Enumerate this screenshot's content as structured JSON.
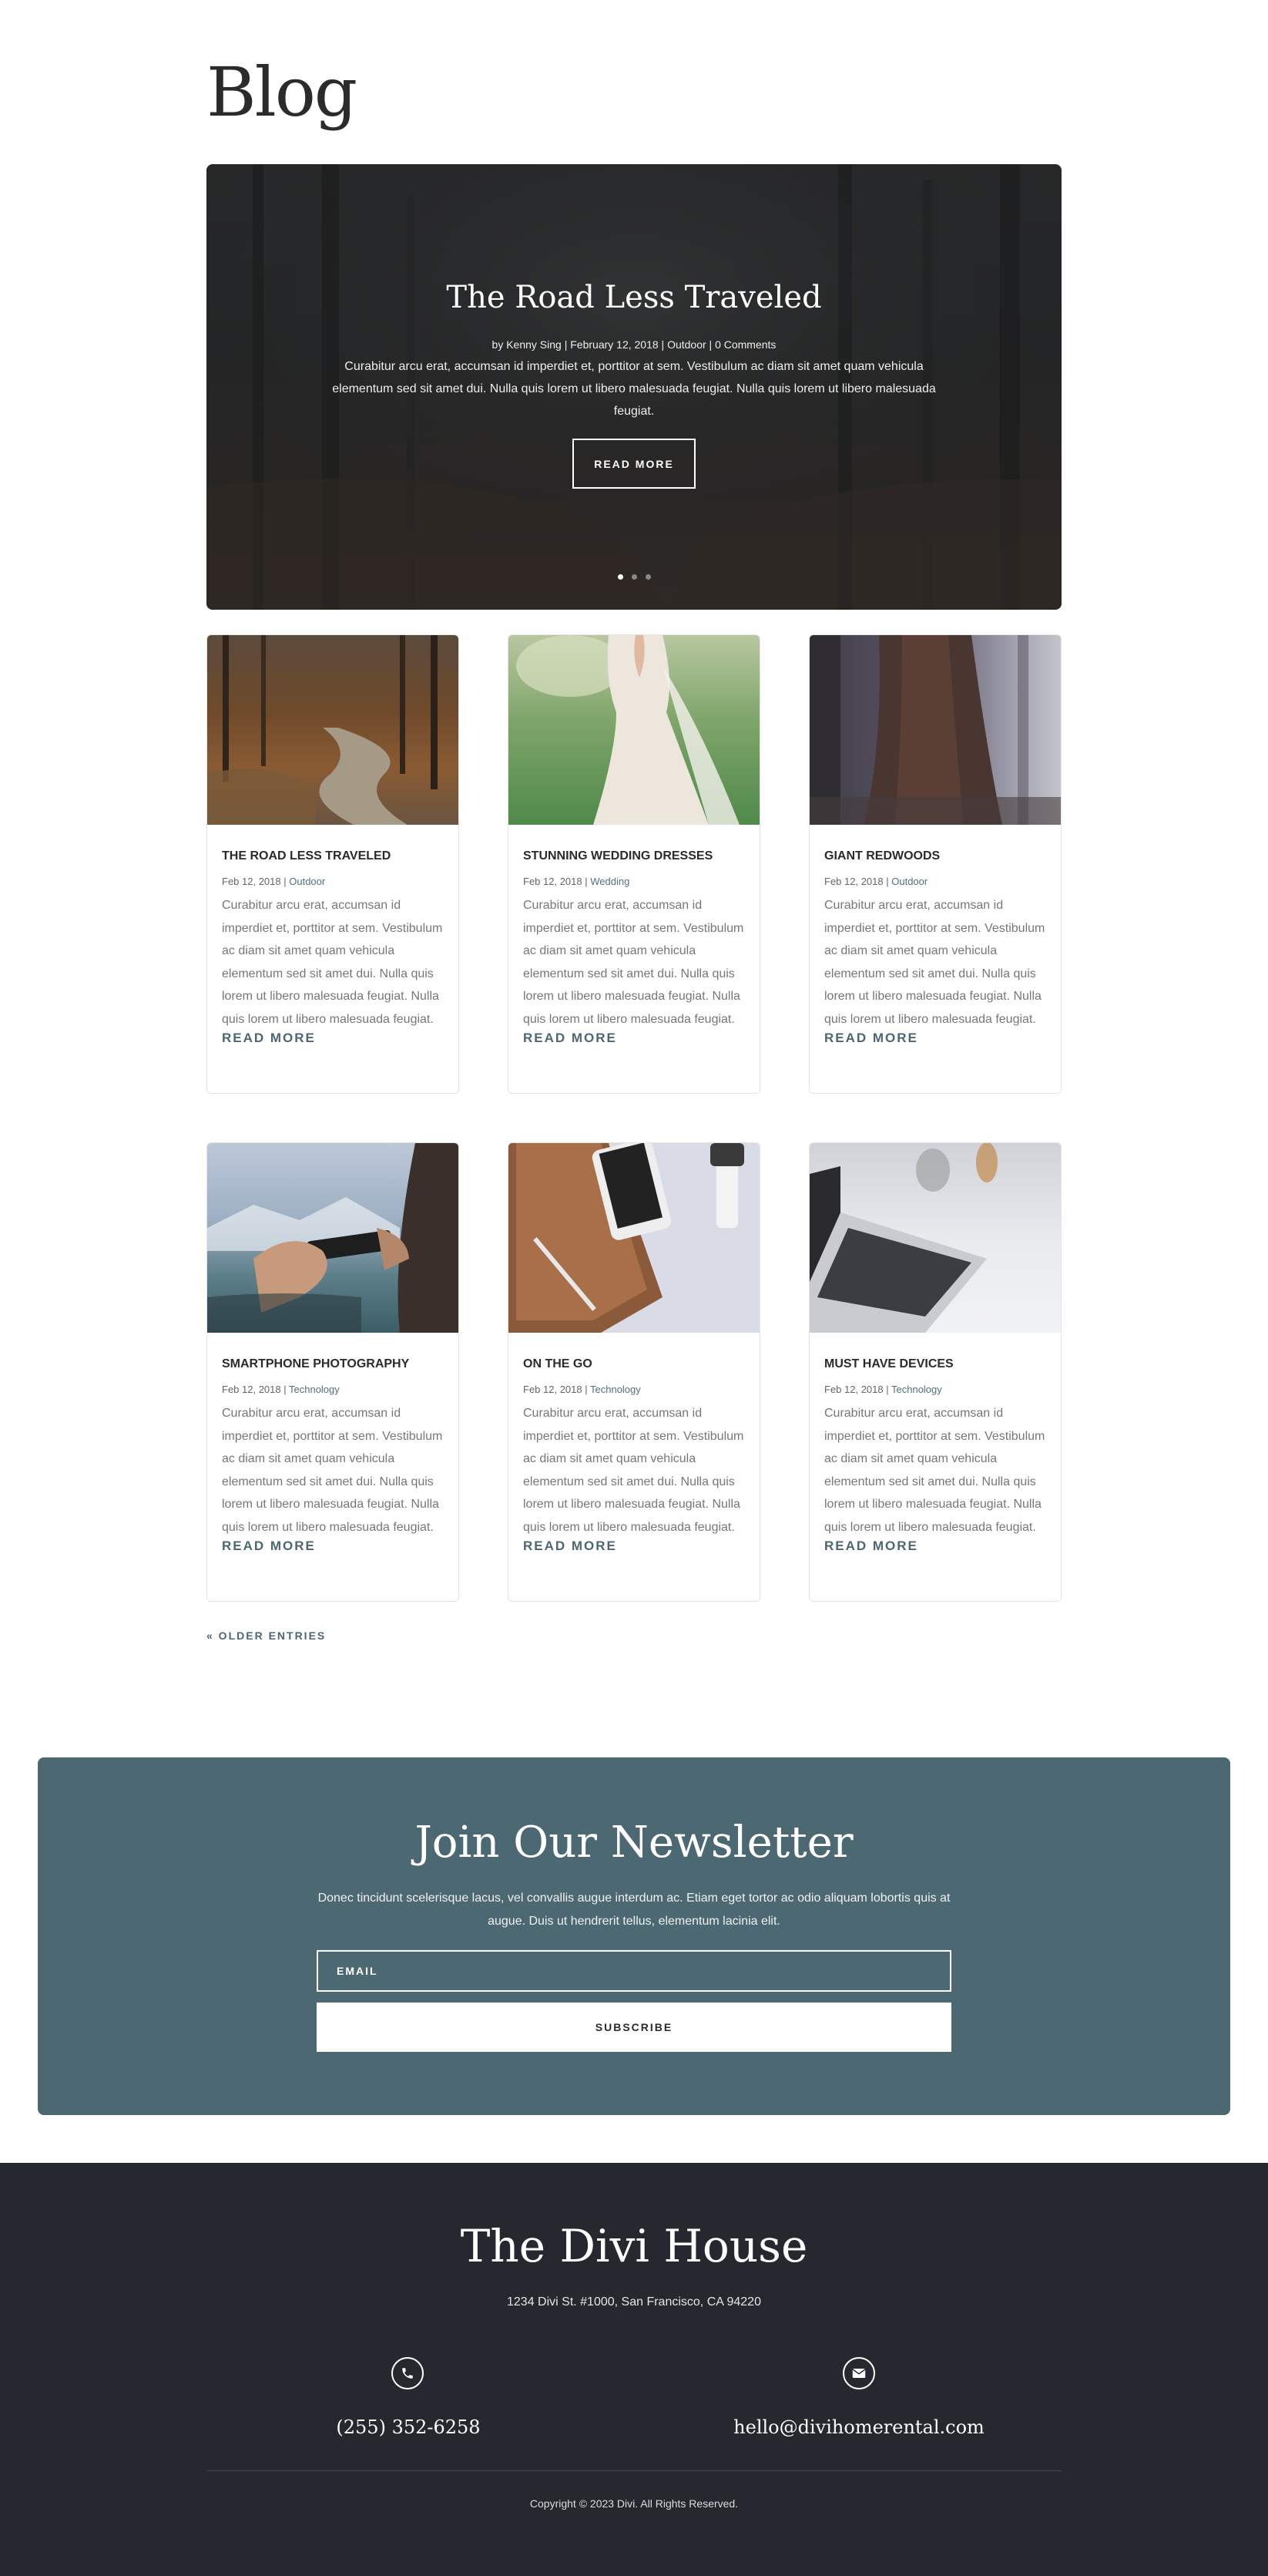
{
  "page": {
    "title": "Blog"
  },
  "hero": {
    "title": "The Road Less Traveled",
    "meta": "by Kenny Sing | February 12, 2018 | Outdoor | 0 Comments",
    "excerpt": "Curabitur arcu erat, accumsan id imperdiet et, porttitor at sem. Vestibulum ac diam sit amet quam vehicula elementum sed sit amet dui. Nulla quis lorem ut libero malesuada feugiat. Nulla quis lorem ut libero malesuada feugiat.",
    "button": "READ MORE",
    "slides": 3,
    "active_slide": 1
  },
  "posts": [
    {
      "title": "THE ROAD LESS TRAVELED",
      "date": "Feb 12, 2018",
      "category": "Outdoor",
      "excerpt": "Curabitur arcu erat, accumsan id imperdiet et, porttitor at sem. Vestibulum ac diam sit amet quam vehicula elementum sed sit amet dui. Nulla quis lorem ut libero malesuada feugiat. Nulla quis lorem ut libero malesuada feugiat.",
      "more": "READ MORE"
    },
    {
      "title": "STUNNING WEDDING DRESSES",
      "date": "Feb 12, 2018",
      "category": "Wedding",
      "excerpt": "Curabitur arcu erat, accumsan id imperdiet et, porttitor at sem. Vestibulum ac diam sit amet quam vehicula elementum sed sit amet dui. Nulla quis lorem ut libero malesuada feugiat. Nulla quis lorem ut libero malesuada feugiat.",
      "more": "READ MORE"
    },
    {
      "title": "GIANT REDWOODS",
      "date": "Feb 12, 2018",
      "category": "Outdoor",
      "excerpt": "Curabitur arcu erat, accumsan id imperdiet et, porttitor at sem. Vestibulum ac diam sit amet quam vehicula elementum sed sit amet dui. Nulla quis lorem ut libero malesuada feugiat. Nulla quis lorem ut libero malesuada feugiat.",
      "more": "READ MORE"
    },
    {
      "title": "SMARTPHONE PHOTOGRAPHY",
      "date": "Feb 12, 2018",
      "category": "Technology",
      "excerpt": "Curabitur arcu erat, accumsan id imperdiet et, porttitor at sem. Vestibulum ac diam sit amet quam vehicula elementum sed sit amet dui. Nulla quis lorem ut libero malesuada feugiat. Nulla quis lorem ut libero malesuada feugiat.",
      "more": "READ MORE"
    },
    {
      "title": "ON THE GO",
      "date": "Feb 12, 2018",
      "category": "Technology",
      "excerpt": "Curabitur arcu erat, accumsan id imperdiet et, porttitor at sem. Vestibulum ac diam sit amet quam vehicula elementum sed sit amet dui. Nulla quis lorem ut libero malesuada feugiat. Nulla quis lorem ut libero malesuada feugiat.",
      "more": "READ MORE"
    },
    {
      "title": "MUST HAVE DEVICES",
      "date": "Feb 12, 2018",
      "category": "Technology",
      "excerpt": "Curabitur arcu erat, accumsan id imperdiet et, porttitor at sem. Vestibulum ac diam sit amet quam vehicula elementum sed sit amet dui. Nulla quis lorem ut libero malesuada feugiat. Nulla quis lorem ut libero malesuada feugiat.",
      "more": "READ MORE"
    }
  ],
  "pagination": {
    "older": "« OLDER ENTRIES"
  },
  "newsletter": {
    "title": "Join Our Newsletter",
    "text": "Donec tincidunt scelerisque lacus, vel convallis augue interdum ac. Etiam eget tortor ac odio aliquam lobortis quis at augue. Duis ut hendrerit tellus, elementum lacinia elit.",
    "email_placeholder": "EMAIL",
    "button": "SUBSCRIBE",
    "bg_color": "#4c6873"
  },
  "footer": {
    "title": "The Divi House",
    "address": "1234 Divi St. #1000, San Francisco, CA 94220",
    "phone_icon": "phone-icon",
    "phone": "(255) 352-6258",
    "email_icon": "envelope-icon",
    "email": "hello@divihomerental.com",
    "copyright": "Copyright © 2023 Divi. All Rights Reserved.",
    "bg_color": "#26282f"
  }
}
